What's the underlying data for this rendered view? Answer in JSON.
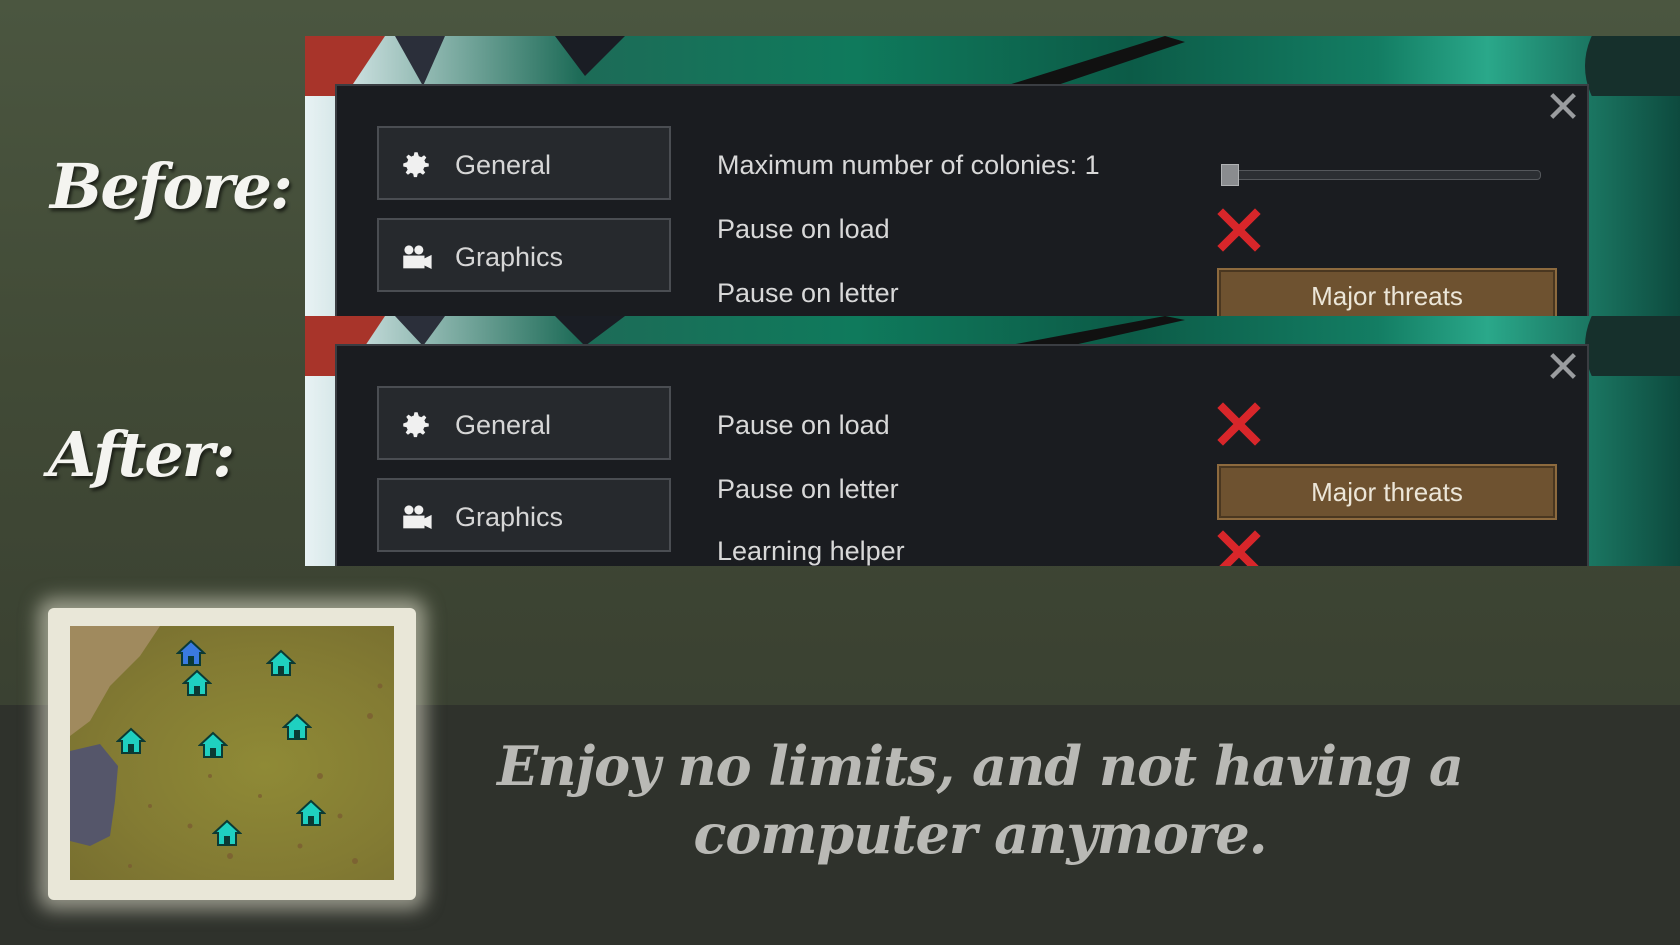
{
  "labels": {
    "before": "Before:",
    "after": "After:"
  },
  "before_panel": {
    "tabs": [
      {
        "label": "General",
        "icon": "gear-icon"
      },
      {
        "label": "Graphics",
        "icon": "camera-icon"
      }
    ],
    "settings": {
      "max_colonies_label": "Maximum number of colonies: 1",
      "max_colonies_slider_value": 1,
      "pause_on_load_label": "Pause on load",
      "pause_on_load_value": "off",
      "pause_on_letter_label": "Pause on letter",
      "pause_on_letter_value": "Major threats"
    },
    "close_icon": "close-icon"
  },
  "after_panel": {
    "tabs": [
      {
        "label": "General",
        "icon": "gear-icon"
      },
      {
        "label": "Graphics",
        "icon": "camera-icon"
      }
    ],
    "settings": {
      "pause_on_load_label": "Pause on load",
      "pause_on_load_value": "off",
      "pause_on_letter_label": "Pause on letter",
      "pause_on_letter_value": "Major threats",
      "learning_helper_label": "Learning helper",
      "learning_helper_value": "off"
    },
    "close_icon": "close-icon"
  },
  "world_map": {
    "colony_count": 8,
    "colony_icon": "house-icon"
  },
  "caption": {
    "line1": "Enjoy no limits, and not having a",
    "line2": "computer anymore."
  },
  "colors": {
    "dialog_bg": "#1a1c20",
    "cancel_red": "#d8262a",
    "button_brown": "#6e5230",
    "colony_cyan": "#1fd0c0"
  }
}
